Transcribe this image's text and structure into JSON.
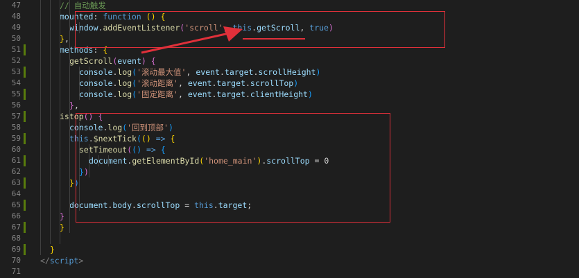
{
  "lines": [
    {
      "num": "47",
      "tokens": [
        [
          "c-comment",
          "// 自动触发"
        ]
      ]
    },
    {
      "num": "48",
      "tokens": [
        [
          "c-prop",
          "mounted"
        ],
        [
          "c-pun",
          ": "
        ],
        [
          "c-key",
          "function"
        ],
        [
          "c-pun",
          " "
        ],
        [
          "c-br1",
          "()"
        ],
        [
          "c-pun",
          " "
        ],
        [
          "c-br1",
          "{"
        ]
      ]
    },
    {
      "num": "49",
      "tokens": [
        [
          "c-prop",
          "window"
        ],
        [
          "c-pun",
          "."
        ],
        [
          "c-fn",
          "addEventListener"
        ],
        [
          "c-br2",
          "("
        ],
        [
          "c-str",
          "'scroll'"
        ],
        [
          "c-pun",
          ", "
        ],
        [
          "c-key",
          "this"
        ],
        [
          "c-pun",
          "."
        ],
        [
          "c-prop",
          "getScroll"
        ],
        [
          "c-pun",
          ", "
        ],
        [
          "c-key",
          "true"
        ],
        [
          "c-br2",
          ")"
        ]
      ]
    },
    {
      "num": "50",
      "tokens": [
        [
          "c-br1",
          "}"
        ],
        [
          "c-pun",
          ","
        ]
      ]
    },
    {
      "num": "51",
      "tokens": [
        [
          "c-prop",
          "methods"
        ],
        [
          "c-pun",
          ": "
        ],
        [
          "c-br1",
          "{"
        ]
      ]
    },
    {
      "num": "52",
      "tokens": [
        [
          "c-fn",
          "getScroll"
        ],
        [
          "c-br2",
          "("
        ],
        [
          "c-prop",
          "event"
        ],
        [
          "c-br2",
          ")"
        ],
        [
          "c-pun",
          " "
        ],
        [
          "c-br2",
          "{"
        ]
      ]
    },
    {
      "num": "53",
      "tokens": [
        [
          "c-prop",
          "console"
        ],
        [
          "c-pun",
          "."
        ],
        [
          "c-fn",
          "log"
        ],
        [
          "c-br3",
          "("
        ],
        [
          "c-str",
          "'滚动最大值'"
        ],
        [
          "c-pun",
          ", "
        ],
        [
          "c-prop",
          "event"
        ],
        [
          "c-pun",
          "."
        ],
        [
          "c-prop",
          "target"
        ],
        [
          "c-pun",
          "."
        ],
        [
          "c-prop",
          "scrollHeight"
        ],
        [
          "c-br3",
          ")"
        ]
      ]
    },
    {
      "num": "54",
      "tokens": [
        [
          "c-prop",
          "console"
        ],
        [
          "c-pun",
          "."
        ],
        [
          "c-fn",
          "log"
        ],
        [
          "c-br3",
          "("
        ],
        [
          "c-str",
          "'滚动距离'"
        ],
        [
          "c-pun",
          ", "
        ],
        [
          "c-prop",
          "event"
        ],
        [
          "c-pun",
          "."
        ],
        [
          "c-prop",
          "target"
        ],
        [
          "c-pun",
          "."
        ],
        [
          "c-prop",
          "scrollTop"
        ],
        [
          "c-br3",
          ")"
        ]
      ]
    },
    {
      "num": "55",
      "tokens": [
        [
          "c-prop",
          "console"
        ],
        [
          "c-pun",
          "."
        ],
        [
          "c-fn",
          "log"
        ],
        [
          "c-br3",
          "("
        ],
        [
          "c-str",
          "'固定距离'"
        ],
        [
          "c-pun",
          ", "
        ],
        [
          "c-prop",
          "event"
        ],
        [
          "c-pun",
          "."
        ],
        [
          "c-prop",
          "target"
        ],
        [
          "c-pun",
          "."
        ],
        [
          "c-prop",
          "clientHeight"
        ],
        [
          "c-br3",
          ")"
        ]
      ]
    },
    {
      "num": "56",
      "tokens": [
        [
          "c-br2",
          "}"
        ],
        [
          "c-pun",
          ","
        ]
      ]
    },
    {
      "num": "57",
      "tokens": [
        [
          "c-fn",
          "istop"
        ],
        [
          "c-br2",
          "()"
        ],
        [
          "c-pun",
          " "
        ],
        [
          "c-br2",
          "{"
        ]
      ]
    },
    {
      "num": "58",
      "tokens": [
        [
          "c-prop",
          "console"
        ],
        [
          "c-pun",
          "."
        ],
        [
          "c-fn",
          "log"
        ],
        [
          "c-br3",
          "("
        ],
        [
          "c-str",
          "'回到顶部'"
        ],
        [
          "c-br3",
          ")"
        ]
      ]
    },
    {
      "num": "59",
      "tokens": [
        [
          "c-key",
          "this"
        ],
        [
          "c-pun",
          "."
        ],
        [
          "c-fn",
          "$nextTick"
        ],
        [
          "c-br3",
          "("
        ],
        [
          "c-br1",
          "()"
        ],
        [
          "c-pun",
          " "
        ],
        [
          "c-key",
          "=>"
        ],
        [
          "c-pun",
          " "
        ],
        [
          "c-br1",
          "{"
        ]
      ]
    },
    {
      "num": "60",
      "tokens": [
        [
          "c-fn",
          "setTimeout"
        ],
        [
          "c-br2",
          "("
        ],
        [
          "c-br3",
          "()"
        ],
        [
          "c-pun",
          " "
        ],
        [
          "c-key",
          "=>"
        ],
        [
          "c-pun",
          " "
        ],
        [
          "c-br3",
          "{"
        ]
      ]
    },
    {
      "num": "61",
      "tokens": [
        [
          "c-prop",
          "document"
        ],
        [
          "c-pun",
          "."
        ],
        [
          "c-fn",
          "getElementById"
        ],
        [
          "c-br1",
          "("
        ],
        [
          "c-str",
          "'home_main'"
        ],
        [
          "c-br1",
          ")"
        ],
        [
          "c-pun",
          "."
        ],
        [
          "c-prop",
          "scrollTop"
        ],
        [
          "c-pun",
          " = "
        ],
        [
          "c-pun",
          "0"
        ]
      ]
    },
    {
      "num": "62",
      "tokens": [
        [
          "c-br3",
          "}"
        ],
        [
          "c-br2",
          ")"
        ]
      ]
    },
    {
      "num": "63",
      "tokens": [
        [
          "c-br1",
          "}"
        ],
        [
          "c-br3",
          ")"
        ]
      ]
    },
    {
      "num": "64",
      "tokens": []
    },
    {
      "num": "65",
      "tokens": [
        [
          "c-prop",
          "document"
        ],
        [
          "c-pun",
          "."
        ],
        [
          "c-prop",
          "body"
        ],
        [
          "c-pun",
          "."
        ],
        [
          "c-prop",
          "scrollTop"
        ],
        [
          "c-pun",
          " = "
        ],
        [
          "c-key",
          "this"
        ],
        [
          "c-pun",
          "."
        ],
        [
          "c-prop",
          "target"
        ],
        [
          "c-pun",
          ";"
        ]
      ]
    },
    {
      "num": "66",
      "tokens": [
        [
          "c-br2",
          "}"
        ]
      ]
    },
    {
      "num": "67",
      "tokens": [
        [
          "c-br1",
          "}"
        ]
      ]
    },
    {
      "num": "68",
      "tokens": []
    },
    {
      "num": "69",
      "tokens": [
        [
          "c-br1",
          "}"
        ]
      ]
    },
    {
      "num": "70",
      "tokens": [
        [
          "c-tag",
          "</"
        ],
        [
          "c-tagname",
          "script"
        ],
        [
          "c-tag",
          ">"
        ]
      ]
    },
    {
      "num": "71",
      "tokens": []
    }
  ],
  "annotation_color": "#e0303a",
  "gutter_change_color": "#587c0c"
}
